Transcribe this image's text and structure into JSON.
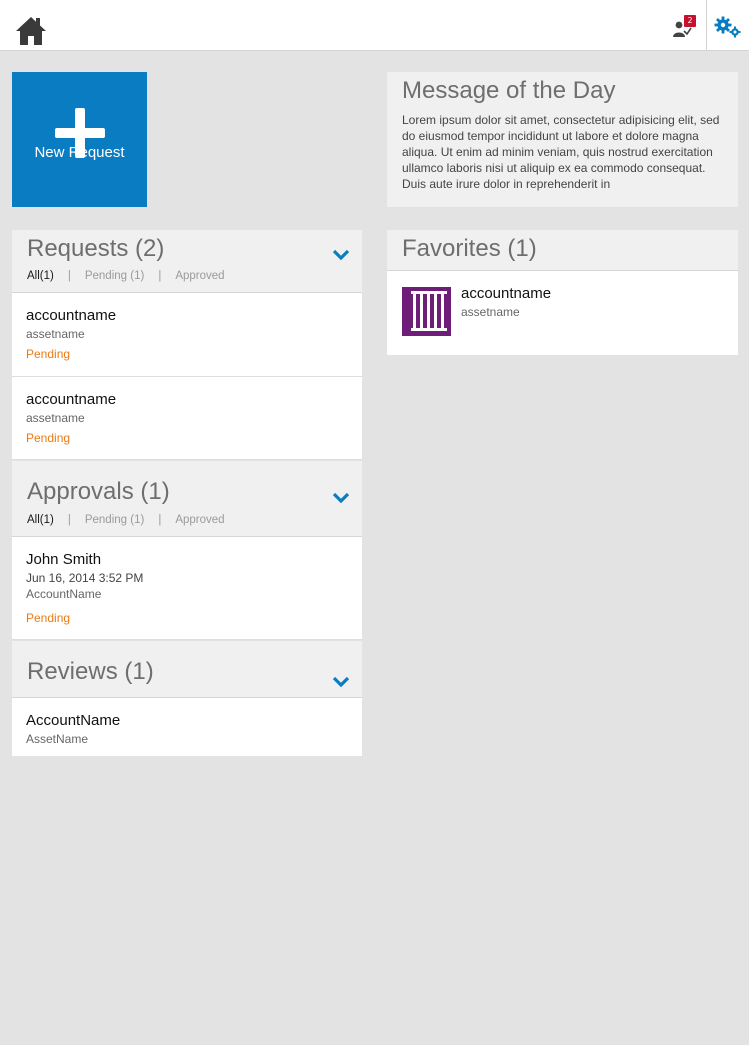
{
  "header": {
    "notifications_count": "2",
    "icons": {
      "home": "home-icon",
      "notifications": "user-requests-icon",
      "settings": "gears-icon"
    }
  },
  "new_request": {
    "label": "New Request"
  },
  "requests": {
    "title": "Requests (2)",
    "filters": {
      "all": "All(1)",
      "pending": "Pending (1)",
      "approved": "Approved",
      "sep": "|"
    },
    "items": [
      {
        "name": "accountname",
        "asset": "assetname",
        "status": "Pending"
      },
      {
        "name": "accountname",
        "asset": "assetname",
        "status": "Pending"
      }
    ]
  },
  "approvals": {
    "title": "Approvals (1)",
    "filters": {
      "all": "All(1)",
      "pending": "Pending (1)",
      "approved": "Approved",
      "sep": "|"
    },
    "items": [
      {
        "name": "John Smith",
        "date": "Jun 16, 2014 3:52 PM",
        "account": "AccountName",
        "status": "Pending"
      }
    ]
  },
  "reviews": {
    "title": "Reviews (1)",
    "items": [
      {
        "name": "AccountName",
        "asset": "AssetName"
      }
    ]
  },
  "motd": {
    "title": "Message of the Day",
    "body": "Lorem ipsum dolor sit amet, consectetur adipisicing elit, sed do eiusmod tempor incididunt ut labore et dolore magna aliqua. Ut enim ad minim veniam, quis nostrud exercitation ullamco laboris nisi ut aliquip ex ea commodo consequat. Duis aute irure dolor in reprehenderit in"
  },
  "favorites": {
    "title": "Favorites (1)",
    "items": [
      {
        "name": "accountname",
        "asset": "assetname",
        "tile_color": "#6e1e78"
      }
    ]
  },
  "colors": {
    "accent": "#0a7dc2",
    "pending": "#ee7a10",
    "favorite_tile": "#6e1e78",
    "badge": "#c8102e"
  }
}
